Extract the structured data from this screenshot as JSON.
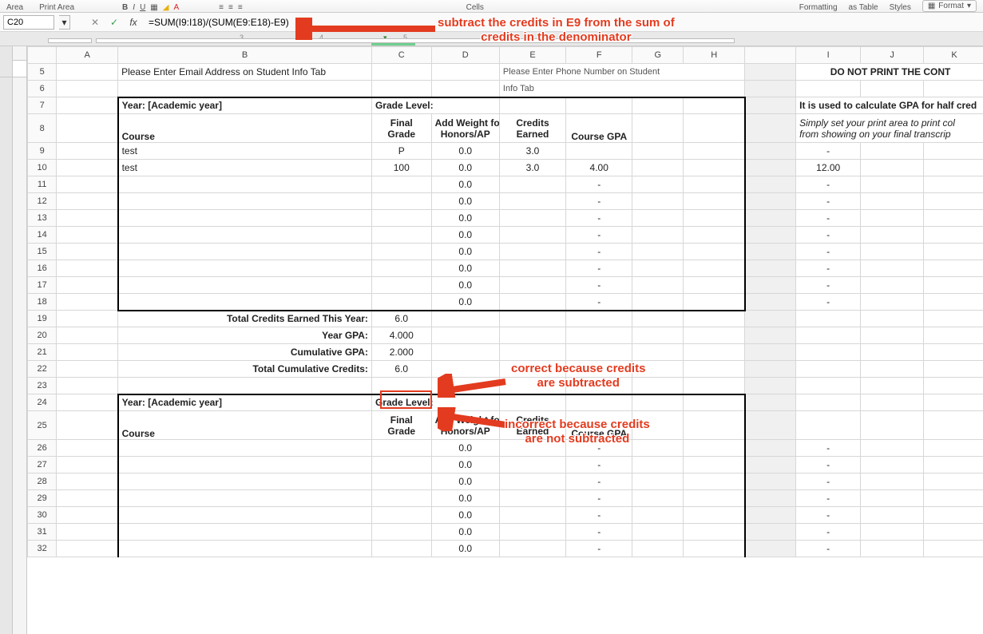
{
  "ribbon": {
    "left_labels": [
      "Area",
      "Print Area"
    ],
    "right_labels": [
      "Formatting",
      "as Table",
      "Styles",
      "Cells"
    ],
    "format_button": "Format"
  },
  "formula_bar": {
    "name_box": "C20",
    "cancel": "✕",
    "confirm": "✓",
    "fx": "fx",
    "formula": "=SUM(I9:I18)/(SUM(E9:E18)-E9)"
  },
  "col_headers": [
    "A",
    "B",
    "C",
    "D",
    "E",
    "F",
    "G",
    "H",
    "I",
    "J",
    "K"
  ],
  "rows": {
    "5": {
      "B": "Please Enter Email Address on Student Info Tab",
      "E": "Please Enter Phone Number on Student",
      "E2": "Info Tab",
      "I": "DO NOT PRINT THE CONT"
    },
    "7": {
      "B": "Year: [Academic year]",
      "C": "Grade Level:",
      "I": "It is used to calculate GPA for half cred"
    },
    "8": {
      "B": "Course",
      "C": "Final",
      "C2": "Grade",
      "D": "Add Weight for",
      "D2": "Honors/AP",
      "E": "Credits",
      "E2": "Earned",
      "F": "Course GPA",
      "I_top": "Simply set your print area to print col",
      "I": "from showing on your final transcrip"
    },
    "9": {
      "B": "test",
      "C": "P",
      "D": "0.0",
      "E": "3.0",
      "I": "-"
    },
    "10": {
      "B": "test",
      "C": "100",
      "D": "0.0",
      "E": "3.0",
      "F": "4.00",
      "I": "12.00"
    },
    "11": {
      "D": "0.0",
      "F": "-",
      "I": "-"
    },
    "12": {
      "D": "0.0",
      "F": "-",
      "I": "-"
    },
    "13": {
      "D": "0.0",
      "F": "-",
      "I": "-"
    },
    "14": {
      "D": "0.0",
      "F": "-",
      "I": "-"
    },
    "15": {
      "D": "0.0",
      "F": "-",
      "I": "-"
    },
    "16": {
      "D": "0.0",
      "F": "-",
      "I": "-"
    },
    "17": {
      "D": "0.0",
      "F": "-",
      "I": "-"
    },
    "18": {
      "D": "0.0",
      "F": "-",
      "I": "-"
    },
    "19": {
      "B": "Total Credits Earned This Year:",
      "C": "6.0"
    },
    "20": {
      "B": "Year GPA:",
      "C": "4.000"
    },
    "21": {
      "B": "Cumulative GPA:",
      "C": "2.000"
    },
    "22": {
      "B": "Total Cumulative Credits:",
      "C": "6.0"
    },
    "24": {
      "B": "Year: [Academic year]",
      "C": "Grade Level:"
    },
    "25": {
      "B": "Course",
      "C": "Final",
      "C2": "Grade",
      "D": "Add Weight for",
      "D2": "Honors/AP",
      "E": "Credits",
      "E2": "Earned",
      "F": "Course GPA"
    },
    "26": {
      "D": "0.0",
      "F": "-",
      "I": "-"
    },
    "27": {
      "D": "0.0",
      "F": "-",
      "I": "-"
    },
    "28": {
      "D": "0.0",
      "F": "-",
      "I": "-"
    },
    "29": {
      "D": "0.0",
      "F": "-",
      "I": "-"
    },
    "30": {
      "D": "0.0",
      "F": "-",
      "I": "-"
    },
    "31": {
      "D": "0.0",
      "F": "-",
      "I": "-"
    },
    "32": {
      "D": "0.0",
      "F": "-",
      "I": "-"
    }
  },
  "annotations": {
    "a1_l1": "subtract the credits in E9 from the sum of",
    "a1_l2": "credits in the denominator",
    "a2_l1": "correct because credits",
    "a2_l2": "are subtracted",
    "a3_l1": "incorrect because credits",
    "a3_l2": "are not subtracted"
  }
}
